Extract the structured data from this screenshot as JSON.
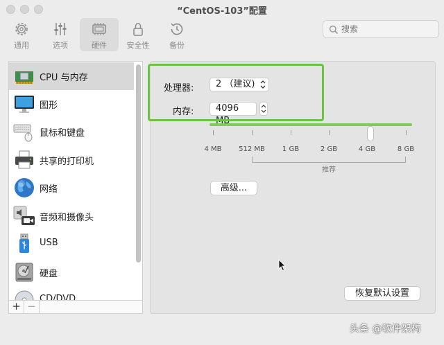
{
  "window": {
    "title": "“CentOS-103”配置"
  },
  "toolbar": {
    "items": [
      {
        "label": "通用",
        "icon": "gear-icon"
      },
      {
        "label": "选项",
        "icon": "sliders-icon"
      },
      {
        "label": "硬件",
        "icon": "chip-icon",
        "active": true
      },
      {
        "label": "安全性",
        "icon": "lock-icon"
      },
      {
        "label": "备份",
        "icon": "clock-icon"
      }
    ],
    "search_placeholder": "搜索"
  },
  "sidebar": {
    "items": [
      {
        "label": "CPU 与内存",
        "icon": "cpu-chip-icon",
        "selected": true
      },
      {
        "label": "图形",
        "icon": "monitor-icon"
      },
      {
        "label": "鼠标和键盘",
        "icon": "keyboard-mouse-icon"
      },
      {
        "label": "共享的打印机",
        "icon": "printer-icon"
      },
      {
        "label": "网络",
        "icon": "globe-icon"
      },
      {
        "label": "音频和摄像头",
        "icon": "speaker-camera-icon"
      },
      {
        "label": "USB",
        "icon": "usb-icon"
      },
      {
        "label": "硬盘",
        "icon": "hard-disk-icon"
      },
      {
        "label": "CD/DVD",
        "icon": "disc-icon"
      }
    ],
    "add_label": "+",
    "remove_label": "−"
  },
  "main": {
    "processor_label": "处理器:",
    "processor_value": "2 （建议)",
    "memory_label": "内存:",
    "memory_value": "4096 MB",
    "slider": {
      "ticks": [
        "4 MB",
        "512 MB",
        "1 GB",
        "2 GB",
        "4 GB",
        "8 GB"
      ],
      "value_fraction": 0.79,
      "recommend_label": "推荐"
    },
    "advanced_button": "高级...",
    "restore_button": "恢复默认设置"
  },
  "watermark": "头条 @软件架构",
  "colors": {
    "accent_green": "#6bc244",
    "slider_fill": "#7dcc5c"
  }
}
